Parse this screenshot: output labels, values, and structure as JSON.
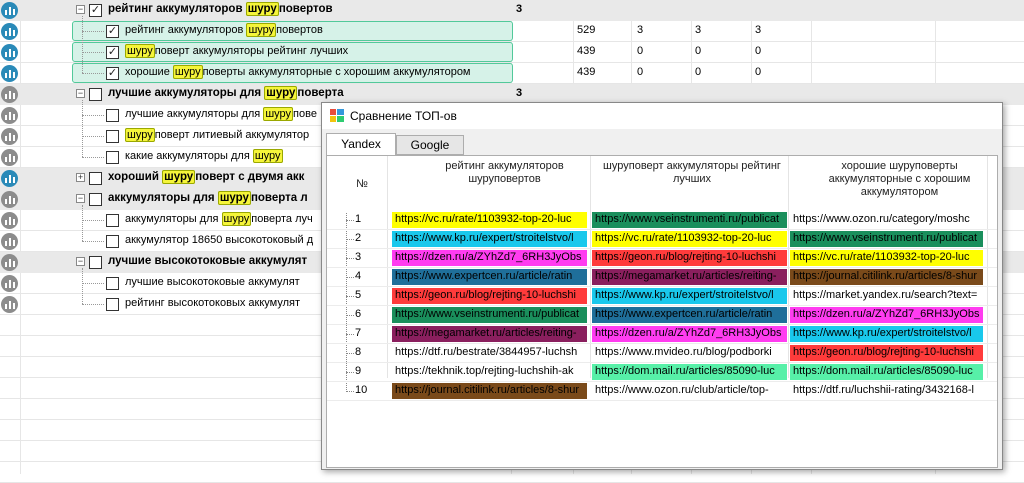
{
  "tree": {
    "rows": [
      {
        "type": "group",
        "checked": true,
        "expanded": true,
        "pre": "рейтинг аккумуляторов ",
        "hl": "шуру",
        "post": "повертов",
        "count": "3",
        "icon": "blue"
      },
      {
        "type": "child",
        "checked": true,
        "pre": "рейтинг аккумуляторов ",
        "hl": "шуру",
        "post": "повертов",
        "n1": "529",
        "n2": "3",
        "n3": "3",
        "n4": "3",
        "icon": "blue",
        "selected": true
      },
      {
        "type": "child",
        "checked": true,
        "pre": "",
        "hl": "шуру",
        "post": "поверт аккумуляторы рейтинг лучших",
        "n1": "439",
        "n2": "0",
        "n3": "0",
        "n4": "0",
        "icon": "blue",
        "selected": true
      },
      {
        "type": "child",
        "checked": true,
        "pre": "хорошие ",
        "hl": "шуру",
        "post": "поверты аккумуляторные с хорошим аккумулятором",
        "n1": "439",
        "n2": "0",
        "n3": "0",
        "n4": "0",
        "icon": "blue",
        "selected": true
      },
      {
        "type": "group",
        "checked": false,
        "expanded": true,
        "pre": "лучшие аккумуляторы для ",
        "hl": "шуру",
        "post": "поверта",
        "count": "3",
        "icon": "gray"
      },
      {
        "type": "child",
        "checked": false,
        "pre": "лучшие аккумуляторы для ",
        "hl": "шуру",
        "post": "пове",
        "icon": "gray"
      },
      {
        "type": "child",
        "checked": false,
        "pre": "",
        "hl": "шуру",
        "post": "поверт литиевый аккумулятор",
        "icon": "gray"
      },
      {
        "type": "child",
        "checked": false,
        "pre": "какие аккумуляторы для ",
        "hl": "шуру",
        "post": "",
        "icon": "gray"
      },
      {
        "type": "group",
        "checked": false,
        "expanded": false,
        "pre": "хороший ",
        "hl": "шуру",
        "post": "поверт с двумя акк",
        "icon": "blue"
      },
      {
        "type": "group",
        "checked": false,
        "expanded": true,
        "pre": "аккумуляторы для ",
        "hl": "шуру",
        "post": "поверта л",
        "icon": "gray"
      },
      {
        "type": "child",
        "checked": false,
        "pre": "аккумуляторы для ",
        "hl": "шуру",
        "post": "поверта луч",
        "icon": "gray"
      },
      {
        "type": "child",
        "checked": false,
        "pre": "аккумулятор 18650 высокотоковый д",
        "hl": "",
        "post": "",
        "icon": "gray"
      },
      {
        "type": "group",
        "checked": false,
        "expanded": true,
        "pre": "лучшие высокотоковые аккумулят",
        "hl": "",
        "post": "",
        "icon": "gray"
      },
      {
        "type": "child",
        "checked": false,
        "pre": "лучшие высокотоковые аккумулят",
        "hl": "",
        "post": "",
        "icon": "gray"
      },
      {
        "type": "child",
        "checked": false,
        "pre": "рейтинг высокотоковых аккумулят",
        "hl": "",
        "post": "",
        "icon": "gray"
      }
    ]
  },
  "dialog": {
    "title": "Сравнение ТОП-ов",
    "tabs": [
      "Yandex",
      "Google"
    ],
    "active_tab": "Yandex",
    "num_header": "№",
    "columns": [
      "рейтинг аккумуляторов шуруповертов",
      "шуруповерт аккумуляторы рейтинг лучших",
      "хорошие шуруповерты аккумуляторные с хорошим аккумулятором"
    ],
    "rows": [
      {
        "n": "1",
        "c": [
          {
            "t": "https://vc.ru/rate/1103932-top-20-luc",
            "bg": "#ffff00"
          },
          {
            "t": "https://www.vseinstrumenti.ru/publicat",
            "bg": "#1a8f5c"
          },
          {
            "t": "https://www.ozon.ru/category/moshc",
            "bg": ""
          }
        ]
      },
      {
        "n": "2",
        "c": [
          {
            "t": "https://www.kp.ru/expert/stroitelstvo/l",
            "bg": "#19c8ec"
          },
          {
            "t": "https://vc.ru/rate/1103932-top-20-luc",
            "bg": "#ffff00"
          },
          {
            "t": "https://www.vseinstrumenti.ru/publicat",
            "bg": "#1a8f5c"
          }
        ]
      },
      {
        "n": "3",
        "c": [
          {
            "t": "https://dzen.ru/a/ZYhZd7_6RH3JyObs",
            "bg": "#ff3cf0"
          },
          {
            "t": "https://geon.ru/blog/rejting-10-luchshi",
            "bg": "#ff3b3b"
          },
          {
            "t": "https://vc.ru/rate/1103932-top-20-luc",
            "bg": "#ffff00"
          }
        ]
      },
      {
        "n": "4",
        "c": [
          {
            "t": "https://www.expertcen.ru/article/ratin",
            "bg": "#1f6f9a"
          },
          {
            "t": "https://megamarket.ru/articles/reiting-",
            "bg": "#8a1f5e"
          },
          {
            "t": "https://journal.citilink.ru/articles/8-shur",
            "bg": "#7a4a1a"
          }
        ]
      },
      {
        "n": "5",
        "c": [
          {
            "t": "https://geon.ru/blog/rejting-10-luchshi",
            "bg": "#ff3b3b"
          },
          {
            "t": "https://www.kp.ru/expert/stroitelstvo/l",
            "bg": "#19c8ec"
          },
          {
            "t": "https://market.yandex.ru/search?text=",
            "bg": ""
          }
        ]
      },
      {
        "n": "6",
        "c": [
          {
            "t": "https://www.vseinstrumenti.ru/publicat",
            "bg": "#1a8f5c"
          },
          {
            "t": "https://www.expertcen.ru/article/ratin",
            "bg": "#1f6f9a"
          },
          {
            "t": "https://dzen.ru/a/ZYhZd7_6RH3JyObs",
            "bg": "#ff3cf0"
          }
        ]
      },
      {
        "n": "7",
        "c": [
          {
            "t": "https://megamarket.ru/articles/reiting-",
            "bg": "#8a1f5e"
          },
          {
            "t": "https://dzen.ru/a/ZYhZd7_6RH3JyObs",
            "bg": "#ff3cf0"
          },
          {
            "t": "https://www.kp.ru/expert/stroitelstvo/l",
            "bg": "#19c8ec"
          }
        ]
      },
      {
        "n": "8",
        "c": [
          {
            "t": "https://dtf.ru/bestrate/3844957-luchsh",
            "bg": ""
          },
          {
            "t": "https://www.mvideo.ru/blog/podborki",
            "bg": ""
          },
          {
            "t": "https://geon.ru/blog/rejting-10-luchshi",
            "bg": "#ff3b3b"
          }
        ]
      },
      {
        "n": "9",
        "c": [
          {
            "t": "https://tekhnik.top/rejting-luchshih-ak",
            "bg": ""
          },
          {
            "t": "https://dom.mail.ru/articles/85090-luc",
            "bg": "#57f0a8"
          },
          {
            "t": "https://dom.mail.ru/articles/85090-luc",
            "bg": "#57f0a8"
          }
        ]
      },
      {
        "n": "10",
        "c": [
          {
            "t": "https://journal.citilink.ru/articles/8-shur",
            "bg": "#7a4a1a"
          },
          {
            "t": "https://www.ozon.ru/club/article/top-",
            "bg": ""
          },
          {
            "t": "https://dtf.ru/luchshii-rating/3432168-l",
            "bg": ""
          }
        ]
      }
    ]
  }
}
